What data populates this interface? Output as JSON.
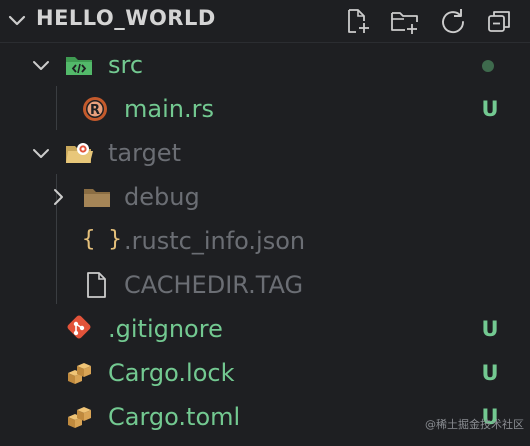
{
  "explorer": {
    "title": "HELLO_WORLD",
    "actions": [
      {
        "name": "new-file",
        "icon": "new-file-icon"
      },
      {
        "name": "new-folder",
        "icon": "new-folder-icon"
      },
      {
        "name": "refresh",
        "icon": "refresh-icon"
      },
      {
        "name": "collapse-all",
        "icon": "collapse-all-icon"
      }
    ]
  },
  "tree": {
    "src": {
      "label": "src",
      "status": "modified-dot"
    },
    "main_rs": {
      "label": "main.rs",
      "status": "U"
    },
    "target": {
      "label": "target"
    },
    "debug": {
      "label": "debug"
    },
    "rustc_info": {
      "label": ".rustc_info.json",
      "icon_text": "{ }"
    },
    "cachedir": {
      "label": "CACHEDIR.TAG"
    },
    "gitignore": {
      "label": ".gitignore",
      "status": "U"
    },
    "cargo_lock": {
      "label": "Cargo.lock",
      "status": "U"
    },
    "cargo_toml": {
      "label": "Cargo.toml",
      "status": "U"
    }
  },
  "watermark": "@稀土掘金技术社区",
  "colors": {
    "background": "#1e1f22",
    "untracked": "#73c991",
    "ignored": "#6b6e74",
    "rust": "#c45a2c",
    "folder_green": "#3f9b52",
    "folder_target": "#e8c77a",
    "git": "#e2533a",
    "json": "#e5c07b"
  }
}
